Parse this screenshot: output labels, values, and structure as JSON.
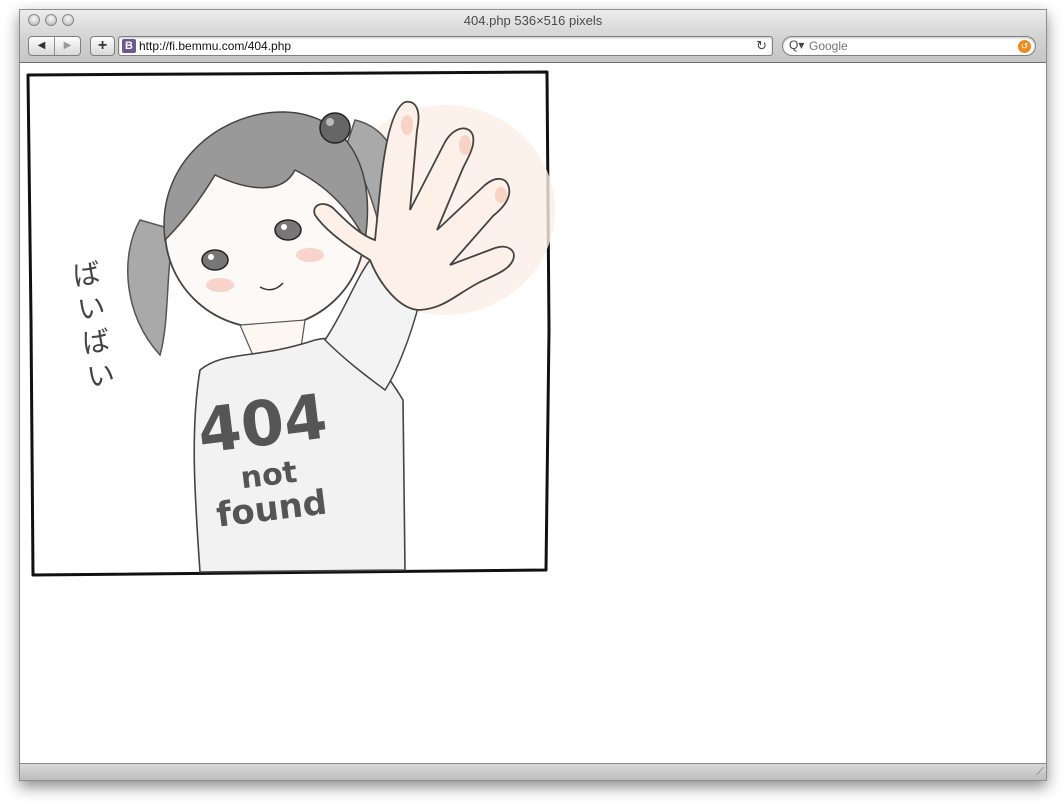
{
  "window": {
    "title": "404.php 536×516 pixels"
  },
  "toolbar": {
    "back_icon": "back-arrow-icon",
    "forward_icon": "forward-arrow-icon",
    "add_bookmark": "+",
    "favicon_letter": "B",
    "url": "http://fi.bemmu.com/404.php",
    "reload_icon": "↻",
    "search_placeholder": "Google",
    "search_glyph": "Q▾"
  },
  "artwork": {
    "shirt_line1": "404",
    "shirt_line2": "not",
    "shirt_line3": "found",
    "side_text": "ばいばい"
  }
}
